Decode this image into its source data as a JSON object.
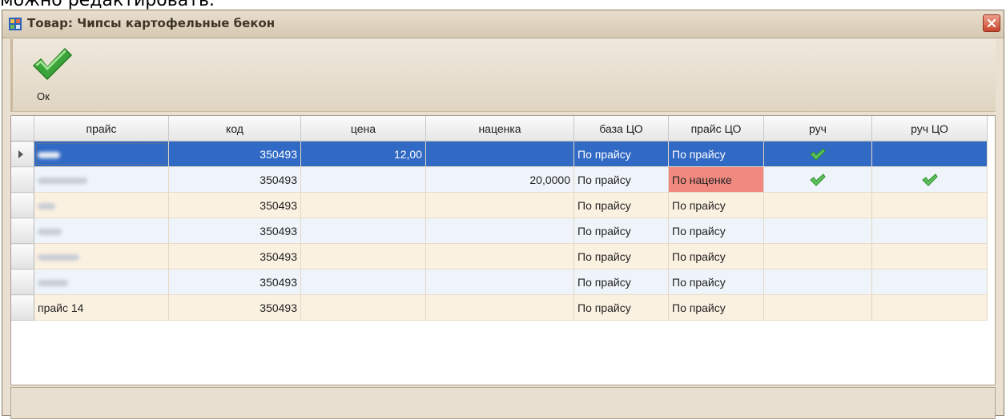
{
  "above_text": "можно редактировать.",
  "window": {
    "title": "Товар: Чипсы картофельные бекон"
  },
  "toolbar": {
    "ok_label": "Ок"
  },
  "grid": {
    "columns": [
      "прайс",
      "код",
      "цена",
      "наценка",
      "база ЦО",
      "прайс ЦО",
      "руч",
      "руч ЦО"
    ],
    "rows": [
      {
        "price_list": "",
        "code": "350493",
        "price": "12,00",
        "markup": "",
        "base_co": "По прайсу",
        "price_co": "По прайсу",
        "manual": true,
        "manual_co": false,
        "selected": true,
        "price_co_alert": false
      },
      {
        "price_list": "",
        "code": "350493",
        "price": "",
        "markup": "20,0000",
        "base_co": "По прайсу",
        "price_co": "По наценке",
        "manual": true,
        "manual_co": true,
        "selected": false,
        "price_co_alert": true
      },
      {
        "price_list": "",
        "code": "350493",
        "price": "",
        "markup": "",
        "base_co": "По прайсу",
        "price_co": "По прайсу",
        "manual": false,
        "manual_co": false,
        "selected": false,
        "price_co_alert": false
      },
      {
        "price_list": "",
        "code": "350493",
        "price": "",
        "markup": "",
        "base_co": "По прайсу",
        "price_co": "По прайсу",
        "manual": false,
        "manual_co": false,
        "selected": false,
        "price_co_alert": false
      },
      {
        "price_list": "",
        "code": "350493",
        "price": "",
        "markup": "",
        "base_co": "По прайсу",
        "price_co": "По прайсу",
        "manual": false,
        "manual_co": false,
        "selected": false,
        "price_co_alert": false
      },
      {
        "price_list": "",
        "code": "350493",
        "price": "",
        "markup": "",
        "base_co": "По прайсу",
        "price_co": "По прайсу",
        "manual": false,
        "manual_co": false,
        "selected": false,
        "price_co_alert": false
      },
      {
        "price_list": "прайс 14",
        "code": "350493",
        "price": "",
        "markup": "",
        "base_co": "По прайсу",
        "price_co": "По прайсу",
        "manual": false,
        "manual_co": false,
        "selected": false,
        "price_co_alert": false
      }
    ]
  },
  "colors": {
    "selection": "#316ac5",
    "alert": "#f08a80",
    "odd_row": "#fbf1e1",
    "even_row": "#eef4fa"
  }
}
